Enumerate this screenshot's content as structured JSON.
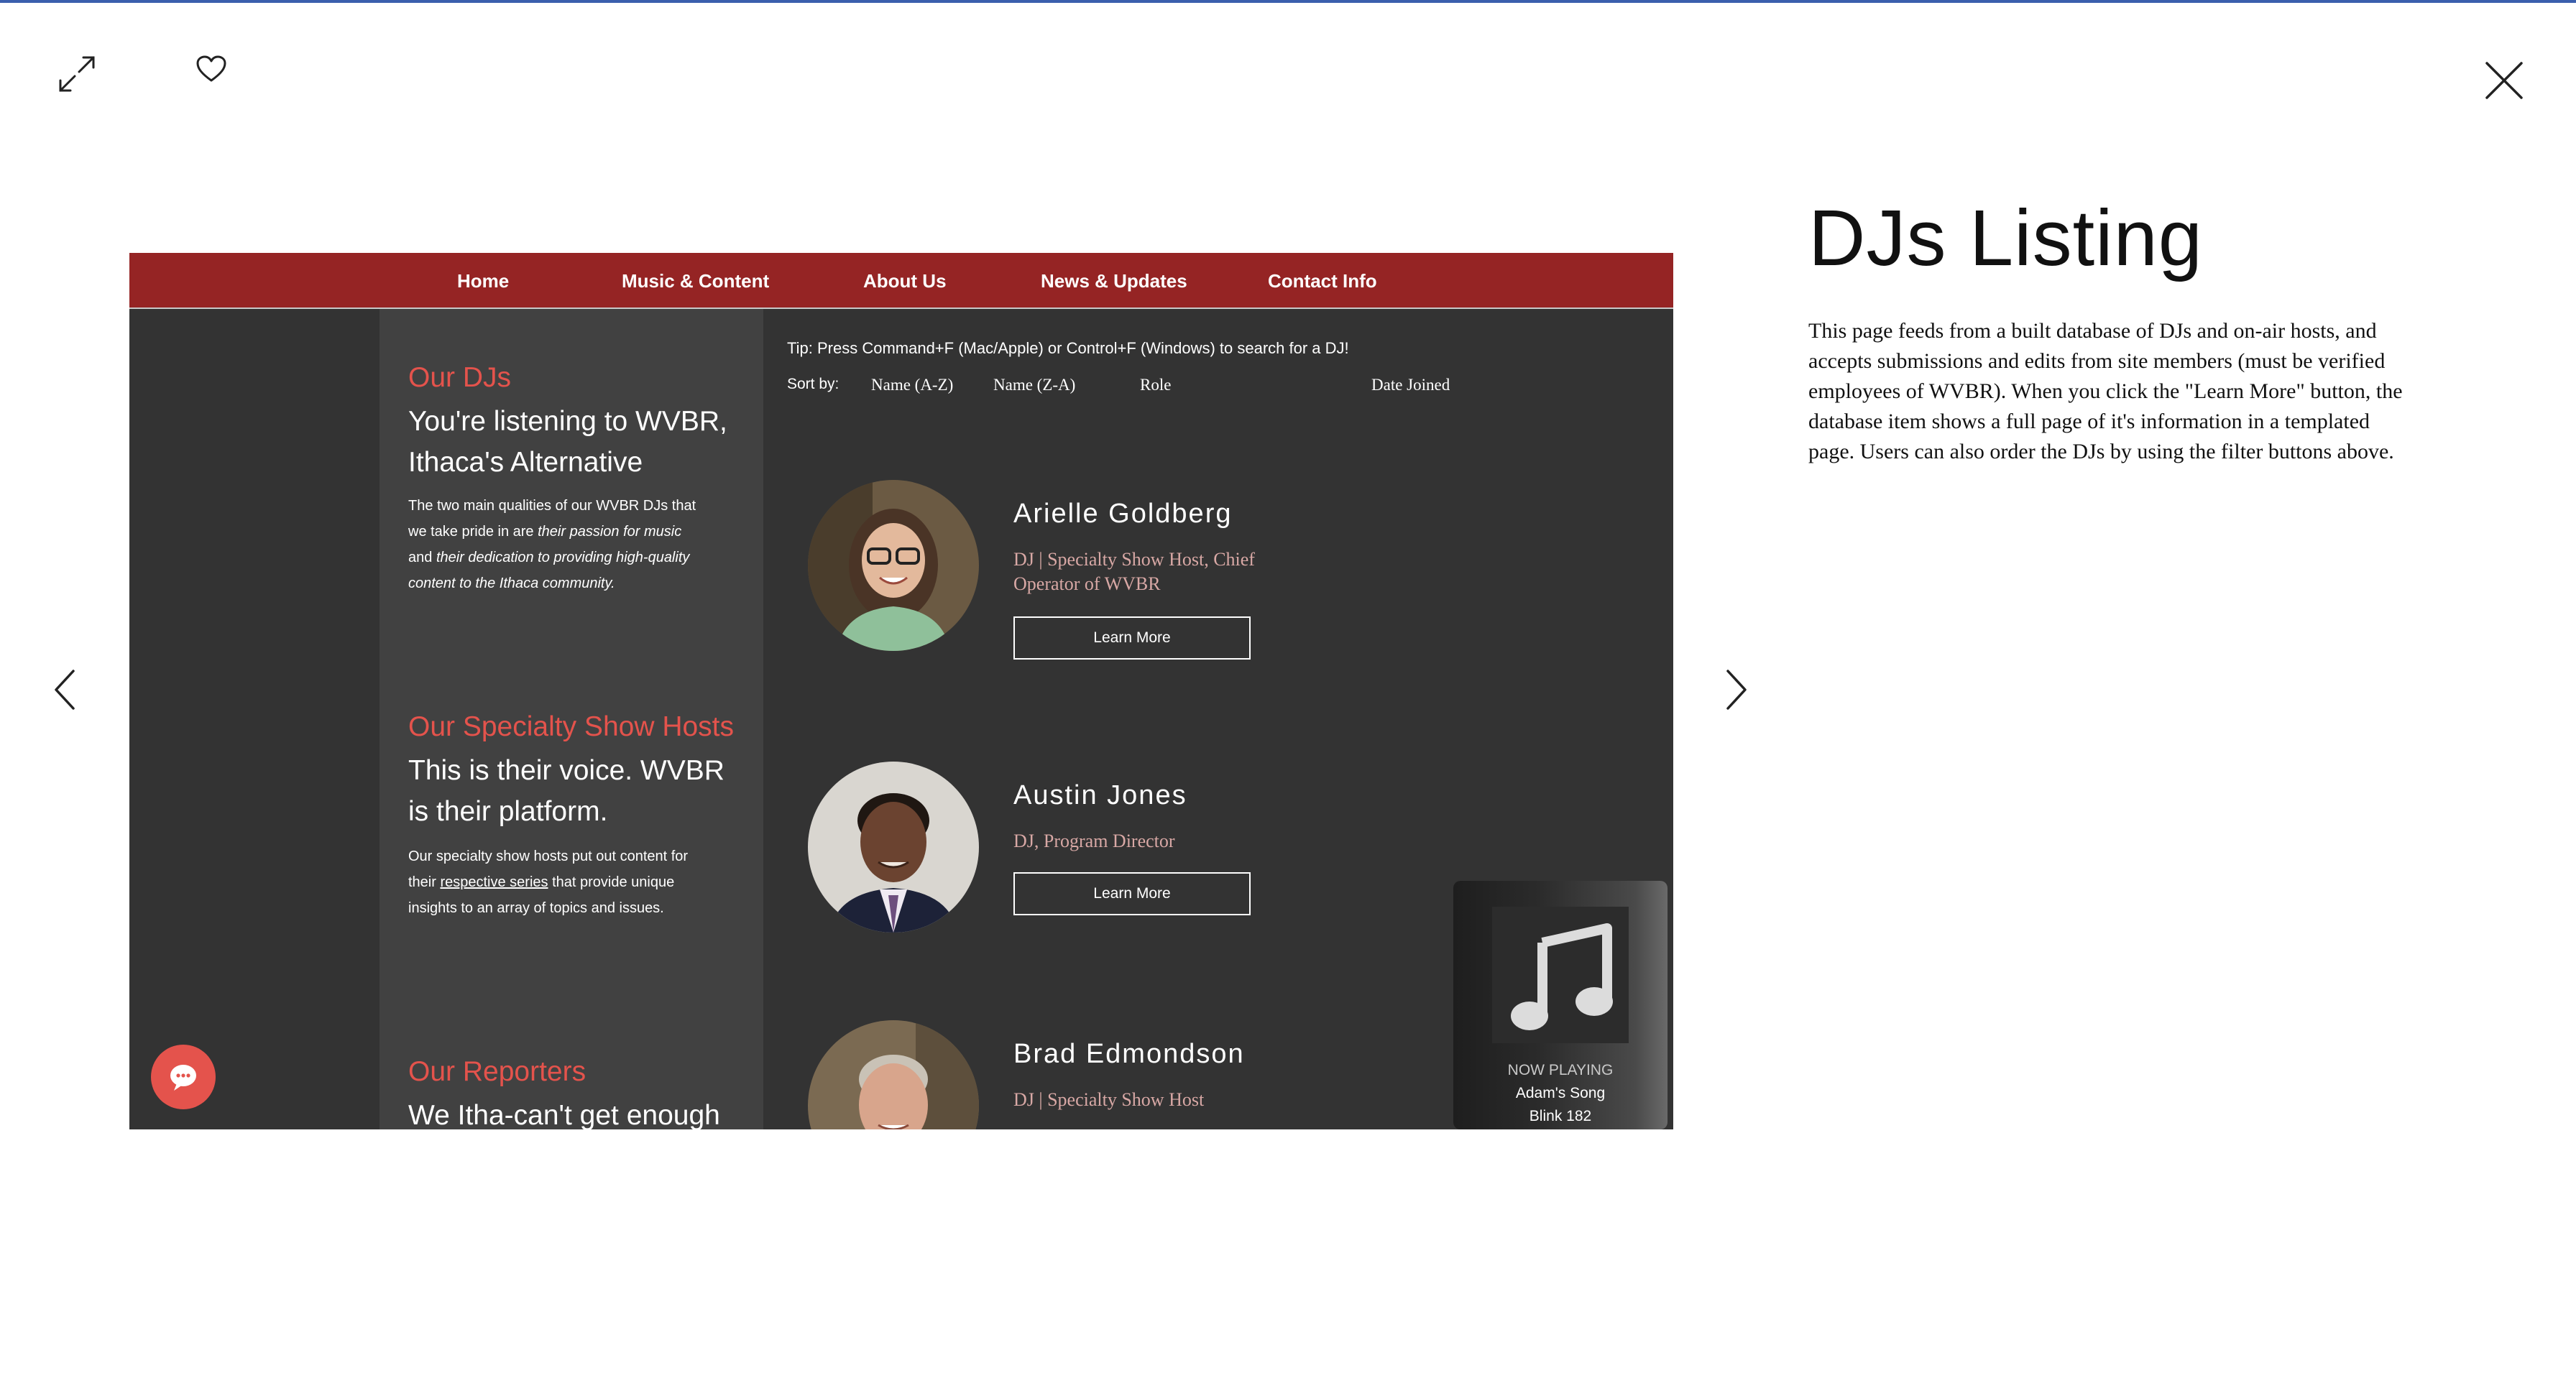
{
  "viewer": {
    "title": "DJs Listing",
    "description": "This page feeds from a built database of DJs and on-air hosts, and accepts submissions and edits from site members (must be verified employees of WVBR). When you click the \"Learn More\" button, the database item shows a full page of it's information in a templated page. Users can also order the DJs by using the filter buttons above."
  },
  "nav": {
    "items": [
      "Home",
      "Music & Content",
      "About Us",
      "News & Updates",
      "Contact Info"
    ]
  },
  "left_column": {
    "djs": {
      "heading": "Our DJs",
      "sub": "You're listening to WVBR, Ithaca's Alternative",
      "body_1": "The two main qualities of our WVBR DJs that we take pride in are ",
      "body_2": "their passion for music",
      "body_3": " and ",
      "body_4": "their dedication to providing high-quality content to the Ithaca community."
    },
    "specialty": {
      "heading": "Our Specialty Show Hosts",
      "sub": "This is their voice. WVBR is their platform.",
      "body_1": "Our specialty show hosts put out content for their ",
      "body_link": "respective series",
      "body_2": " that provide unique insights to an array of topics and issues."
    },
    "reporters": {
      "heading": "Our Reporters",
      "sub": "We Itha-can't get enough"
    }
  },
  "listing": {
    "tip": "Tip: Press Command+F (Mac/Apple) or Control+F (Windows) to search for a DJ!",
    "sort_label": "Sort by:",
    "sort_options": [
      "Name (A-Z)",
      "Name (Z-A)",
      "Role",
      "Date Joined"
    ],
    "button_label": "Learn More",
    "djs": [
      {
        "name": "Arielle Goldberg",
        "role": "DJ | Specialty Show Host, Chief Operator of WVBR"
      },
      {
        "name": "Austin Jones",
        "role": "DJ, Program Director"
      },
      {
        "name": "Brad Edmondson",
        "role": "DJ | Specialty Show Host"
      }
    ]
  },
  "player": {
    "label": "NOW PLAYING",
    "song": "Adam's Song",
    "artist": "Blink 182"
  },
  "icons": {
    "expand": "expand-icon",
    "heart": "heart-icon",
    "close": "close-icon",
    "prev": "chevron-left-icon",
    "next": "chevron-right-icon",
    "music": "music-note-icon",
    "chat": "chat-icon"
  },
  "colors": {
    "nav_bg": "#952424",
    "accent_red": "#e4534c",
    "role_text": "#d8a8a5",
    "dark_bg": "#333333"
  }
}
